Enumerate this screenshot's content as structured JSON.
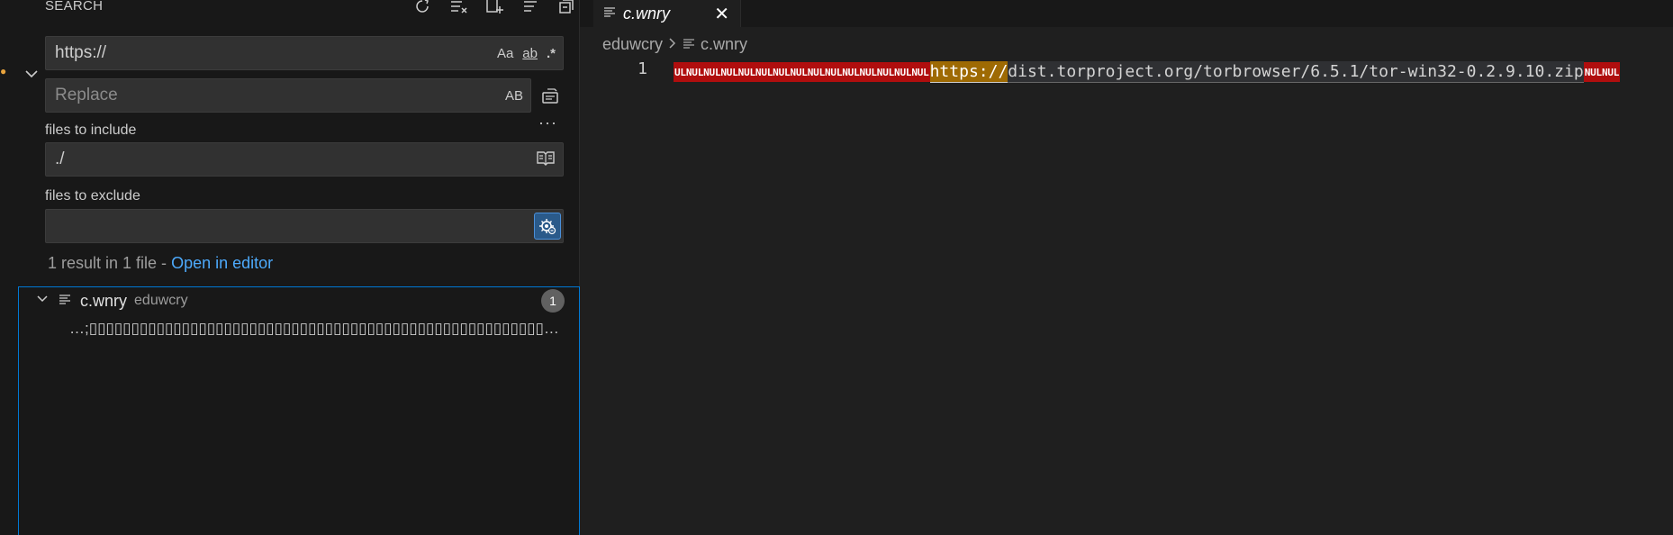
{
  "sidebar": {
    "title": "SEARCH",
    "actions": [
      "refresh-icon",
      "clear-results-icon",
      "new-search-editor-icon",
      "view-as-tree-icon",
      "collapse-all-icon"
    ],
    "search": {
      "value": "https://",
      "options": [
        "Aa",
        "ab",
        ".*"
      ]
    },
    "replace": {
      "placeholder": "Replace",
      "option": "AB"
    },
    "include": {
      "label": "files to include",
      "value": "./"
    },
    "exclude": {
      "label": "files to exclude",
      "value": ""
    },
    "summary": {
      "text": "1 result in 1 file - ",
      "link": "Open in editor"
    },
    "results": {
      "file": {
        "name": "c.wnry",
        "dir": "eduwcry",
        "count": "1"
      },
      "match": "…;▯▯▯▯▯▯▯▯▯▯▯▯▯▯▯▯▯▯▯▯▯▯▯▯▯▯▯▯▯▯▯▯▯▯▯▯▯▯▯▯▯▯▯▯▯▯▯▯▯▯▯▯▯▯…"
    }
  },
  "editor": {
    "tab": {
      "name": "c.wnry"
    },
    "breadcrumb": {
      "folder": "eduwcry",
      "file": "c.wnry"
    },
    "line": {
      "number": "1",
      "nul_prefix": "ULNULNULNULNULNULNULNULNULNULNULNULNULNULNUL",
      "match": "https://",
      "rest": "dist.torproject.org/torbrowser/6.5.1/tor-win32-0.2.9.10.zip",
      "nul_suffix": "NULNUL"
    }
  },
  "colors": {
    "accent": "#0078d4",
    "link": "#4daafc",
    "match_highlight": "#9e6a03",
    "nul_badge": "#b00e0e"
  }
}
